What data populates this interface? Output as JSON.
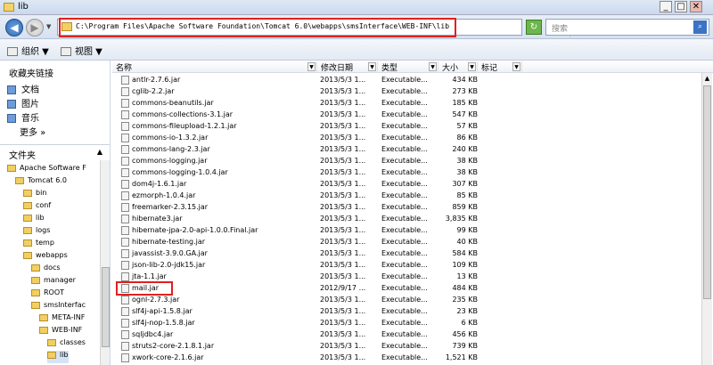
{
  "window": {
    "title": "lib",
    "minimize": "_",
    "maximize": "□",
    "close": "✕"
  },
  "address": {
    "path": "C:\\Program Files\\Apache Software Foundation\\Tomcat 6.0\\webapps\\smsInterface\\WEB-INF\\lib",
    "search_placeholder": "搜索"
  },
  "toolbar": {
    "organize": "组织 ▼",
    "view": "视图 ▼"
  },
  "favorites": {
    "heading": "收藏夹链接",
    "items": [
      {
        "label": "文档"
      },
      {
        "label": "图片"
      },
      {
        "label": "音乐"
      },
      {
        "label": "更多 »"
      }
    ]
  },
  "folders": {
    "heading": "文件夹",
    "tree": [
      {
        "label": "Apache Software F",
        "depth": 1
      },
      {
        "label": "Tomcat 6.0",
        "depth": 2
      },
      {
        "label": "bin",
        "depth": 3
      },
      {
        "label": "conf",
        "depth": 3
      },
      {
        "label": "lib",
        "depth": 3
      },
      {
        "label": "logs",
        "depth": 3
      },
      {
        "label": "temp",
        "depth": 3
      },
      {
        "label": "webapps",
        "depth": 3
      },
      {
        "label": "docs",
        "depth": 4
      },
      {
        "label": "manager",
        "depth": 4
      },
      {
        "label": "ROOT",
        "depth": 4
      },
      {
        "label": "smsInterfac",
        "depth": 4
      },
      {
        "label": "META-INF",
        "depth": 5
      },
      {
        "label": "WEB-INF",
        "depth": 5
      },
      {
        "label": "classes",
        "depth": 6
      },
      {
        "label": "lib",
        "depth": 6
      }
    ]
  },
  "columns": {
    "name": "名称",
    "date": "修改日期",
    "type": "类型",
    "size": "大小",
    "tags": "标记"
  },
  "files": [
    {
      "name": "antlr-2.7.6.jar",
      "date": "2013/5/3 1...",
      "type": "Executable...",
      "size": "434 KB"
    },
    {
      "name": "cglib-2.2.jar",
      "date": "2013/5/3 1...",
      "type": "Executable...",
      "size": "273 KB"
    },
    {
      "name": "commons-beanutils.jar",
      "date": "2013/5/3 1...",
      "type": "Executable...",
      "size": "185 KB"
    },
    {
      "name": "commons-collections-3.1.jar",
      "date": "2013/5/3 1...",
      "type": "Executable...",
      "size": "547 KB"
    },
    {
      "name": "commons-fileupload-1.2.1.jar",
      "date": "2013/5/3 1...",
      "type": "Executable...",
      "size": "57 KB"
    },
    {
      "name": "commons-io-1.3.2.jar",
      "date": "2013/5/3 1...",
      "type": "Executable...",
      "size": "86 KB"
    },
    {
      "name": "commons-lang-2.3.jar",
      "date": "2013/5/3 1...",
      "type": "Executable...",
      "size": "240 KB"
    },
    {
      "name": "commons-logging.jar",
      "date": "2013/5/3 1...",
      "type": "Executable...",
      "size": "38 KB"
    },
    {
      "name": "commons-logging-1.0.4.jar",
      "date": "2013/5/3 1...",
      "type": "Executable...",
      "size": "38 KB"
    },
    {
      "name": "dom4j-1.6.1.jar",
      "date": "2013/5/3 1...",
      "type": "Executable...",
      "size": "307 KB"
    },
    {
      "name": "ezmorph-1.0.4.jar",
      "date": "2013/5/3 1...",
      "type": "Executable...",
      "size": "85 KB"
    },
    {
      "name": "freemarker-2.3.15.jar",
      "date": "2013/5/3 1...",
      "type": "Executable...",
      "size": "859 KB"
    },
    {
      "name": "hibernate3.jar",
      "date": "2013/5/3 1...",
      "type": "Executable...",
      "size": "3,835 KB"
    },
    {
      "name": "hibernate-jpa-2.0-api-1.0.0.Final.jar",
      "date": "2013/5/3 1...",
      "type": "Executable...",
      "size": "99 KB"
    },
    {
      "name": "hibernate-testing.jar",
      "date": "2013/5/3 1...",
      "type": "Executable...",
      "size": "40 KB"
    },
    {
      "name": "javassist-3.9.0.GA.jar",
      "date": "2013/5/3 1...",
      "type": "Executable...",
      "size": "584 KB"
    },
    {
      "name": "json-lib-2.0-jdk15.jar",
      "date": "2013/5/3 1...",
      "type": "Executable...",
      "size": "109 KB"
    },
    {
      "name": "jta-1.1.jar",
      "date": "2013/5/3 1...",
      "type": "Executable...",
      "size": "13 KB"
    },
    {
      "name": "mail.jar",
      "date": "2012/9/17 ...",
      "type": "Executable...",
      "size": "484 KB"
    },
    {
      "name": "ognl-2.7.3.jar",
      "date": "2013/5/3 1...",
      "type": "Executable...",
      "size": "235 KB"
    },
    {
      "name": "slf4j-api-1.5.8.jar",
      "date": "2013/5/3 1...",
      "type": "Executable...",
      "size": "23 KB"
    },
    {
      "name": "slf4j-nop-1.5.8.jar",
      "date": "2013/5/3 1...",
      "type": "Executable...",
      "size": "6 KB"
    },
    {
      "name": "sqljdbc4.jar",
      "date": "2013/5/3 1...",
      "type": "Executable...",
      "size": "456 KB"
    },
    {
      "name": "struts2-core-2.1.8.1.jar",
      "date": "2013/5/3 1...",
      "type": "Executable...",
      "size": "739 KB"
    },
    {
      "name": "xwork-core-2.1.6.jar",
      "date": "2013/5/3 1...",
      "type": "Executable...",
      "size": "1,521 KB"
    }
  ],
  "colors": {
    "highlight": "#e02020",
    "accent": "#3b72c4"
  }
}
